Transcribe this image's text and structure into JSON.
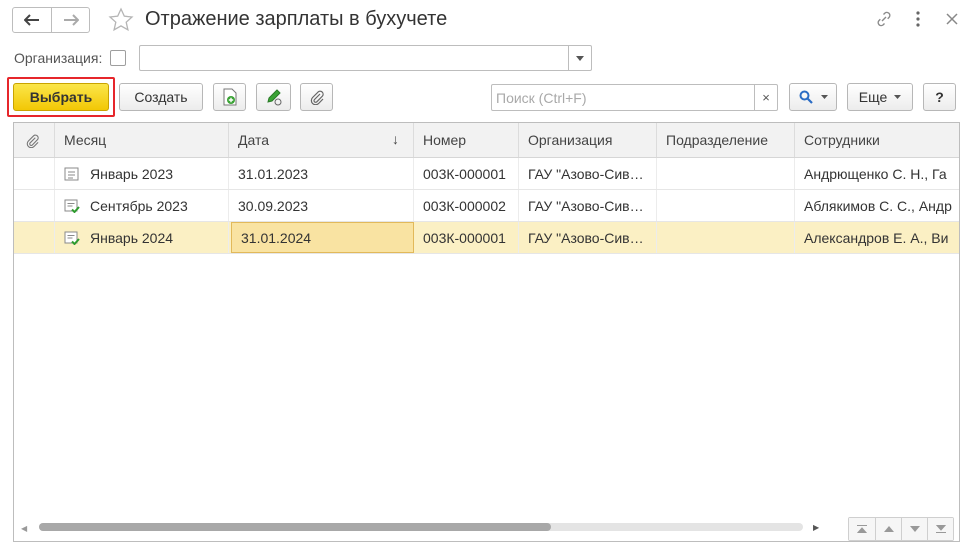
{
  "window": {
    "title": "Отражение зарплаты в бухучете"
  },
  "filter": {
    "organization_label": "Организация:",
    "organization_value": ""
  },
  "toolbar": {
    "select_label": "Выбрать",
    "create_label": "Создать",
    "search_placeholder": "Поиск (Ctrl+F)",
    "search_clear": "×",
    "more_label": "Еще",
    "help_label": "?"
  },
  "table": {
    "columns": {
      "attachment": "",
      "month": "Месяц",
      "date": "Дата",
      "date_sort_indicator": "↓",
      "number": "Номер",
      "organization": "Организация",
      "department": "Подразделение",
      "employees": "Сотрудники"
    },
    "rows": [
      {
        "month": "Январь 2023",
        "date": "31.01.2023",
        "number": "003К-000001",
        "organization": "ГАУ \"Азово-Сив…",
        "department": "",
        "employees": "Андрющенко С. Н., Га",
        "status": "draft"
      },
      {
        "month": "Сентябрь 2023",
        "date": "30.09.2023",
        "number": "003К-000002",
        "organization": "ГАУ \"Азово-Сив…",
        "department": "",
        "employees": "Аблякимов С. С., Андр",
        "status": "posted"
      },
      {
        "month": "Январь 2024",
        "date": "31.01.2024",
        "number": "003К-000001",
        "organization": "ГАУ \"Азово-Сив…",
        "department": "",
        "employees": "Александров Е. А., Ви",
        "status": "posted"
      }
    ],
    "selected_row_index": 2
  },
  "scrollbar": {
    "horizontal_position_fraction": 0.67
  },
  "colors": {
    "primary_button": "#f5d013",
    "highlight_frame": "#e6262b",
    "selected_row": "#fbf0c4",
    "posted_icon_green": "#2e9b2e"
  },
  "icons": {
    "back": "arrow-left-icon",
    "forward": "arrow-right-icon",
    "favorite": "star-icon",
    "link": "link-icon",
    "menu": "kebab-menu-icon",
    "close": "close-icon",
    "create_copy": "add-copy-icon",
    "edit": "pencil-edit-icon",
    "attach": "paperclip-icon",
    "search": "magnifier-icon"
  }
}
